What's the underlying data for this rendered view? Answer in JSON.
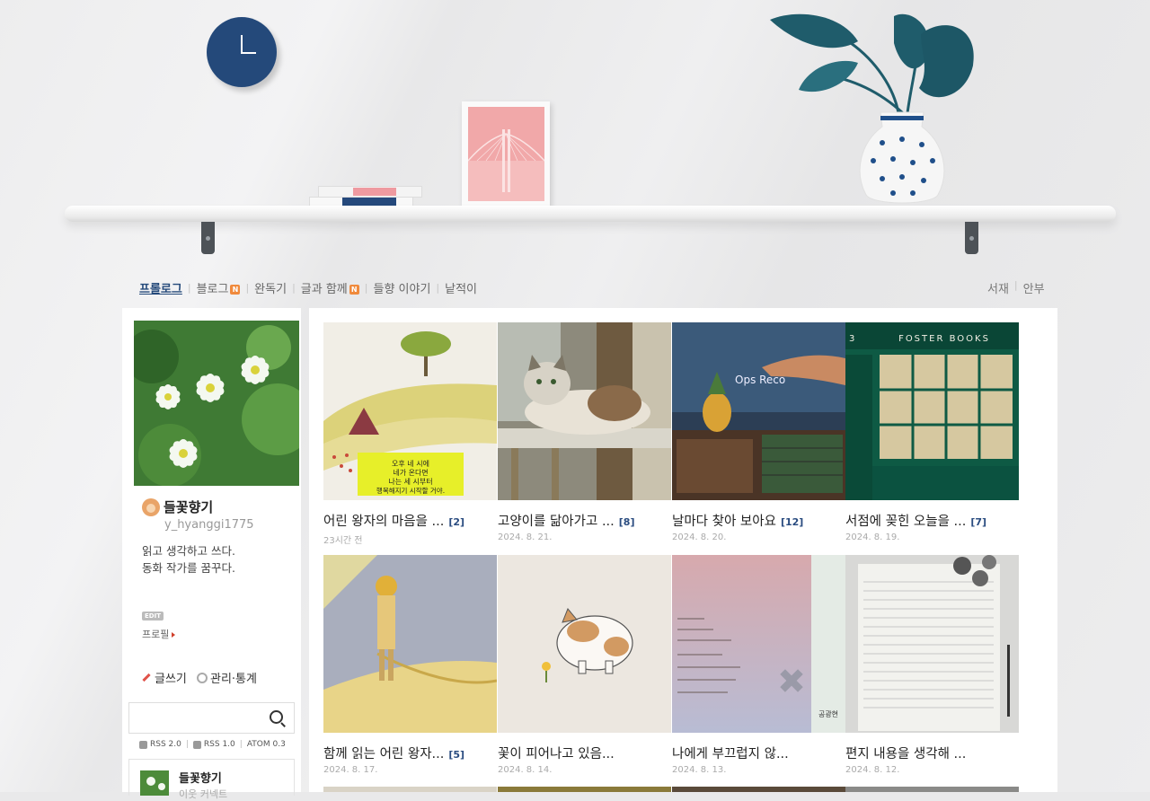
{
  "nav": {
    "left": [
      {
        "label": "프롤로그",
        "active": true,
        "badge": ""
      },
      {
        "label": "블로그",
        "active": false,
        "badge": "N"
      },
      {
        "label": "완독기",
        "active": false,
        "badge": ""
      },
      {
        "label": "글과 함께",
        "active": false,
        "badge": "N"
      },
      {
        "label": "들향 이야기",
        "active": false,
        "badge": ""
      },
      {
        "label": "낱적이",
        "active": false,
        "badge": ""
      }
    ],
    "right": [
      {
        "label": "서재"
      },
      {
        "label": "안부"
      }
    ]
  },
  "sidebar": {
    "blog_name": "들꽃향기",
    "blog_id": "y_hyanggi1775",
    "desc_line1": "읽고 생각하고 쓰다.",
    "desc_line2": "동화 작가를 꿈꾸다.",
    "edit_badge": "EDIT",
    "profile_link": "프로필",
    "write": "글쓰기",
    "manage": "관리·통계",
    "search_placeholder": "",
    "rss": [
      "RSS 2.0",
      "RSS 1.0",
      "ATOM 0.3"
    ],
    "mini_profile_title": "들꽃향기",
    "mini_profile_sub": "이웃 커넥트"
  },
  "posts": [
    {
      "title": "어린 왕자의 마음을 ...",
      "comments": "[2]",
      "date": "23시간 전",
      "thumb": "prince-hill"
    },
    {
      "title": "고양이를 닮아가고 ...",
      "comments": "[8]",
      "date": "2024. 8. 21.",
      "thumb": "cat-photo"
    },
    {
      "title": "날마다 찾아 보아요",
      "comments": "[12]",
      "date": "2024. 8. 20.",
      "thumb": "record-shop"
    },
    {
      "title": "서점에 꽂힌 오늘을 ...",
      "comments": "[7]",
      "date": "2024. 8. 19.",
      "thumb": "foster-books"
    },
    {
      "title": "함께 읽는 어린 왕자...",
      "comments": "[5]",
      "date": "2024. 8. 17.",
      "thumb": "little-prince"
    },
    {
      "title": "꽃이 피어나고 있음...",
      "comments": "",
      "date": "2024. 8. 14.",
      "thumb": "cat-drawing"
    },
    {
      "title": "나에게 부끄럽지 않...",
      "comments": "",
      "date": "2024. 8. 13.",
      "thumb": "book-page"
    },
    {
      "title": "편지 내용을 생각해 ...",
      "comments": "",
      "date": "2024. 8. 12.",
      "thumb": "notebook"
    }
  ],
  "thumb_texts": {
    "prince_sign": [
      "오후 네 시에",
      "네가 온다면",
      "나는 세 시부터",
      "행복해지기 시작할 거야."
    ],
    "foster_sign": "FOSTER BOOKS",
    "foster_num": "3",
    "record_sign": "Ops Reco",
    "book_page_author": "공광현"
  },
  "colors": {
    "accent": "#24497a",
    "badge": "#f08a3c",
    "clock": "#24497a",
    "frame_art": "#f1a8a9",
    "plant": "#1f5c6b"
  }
}
